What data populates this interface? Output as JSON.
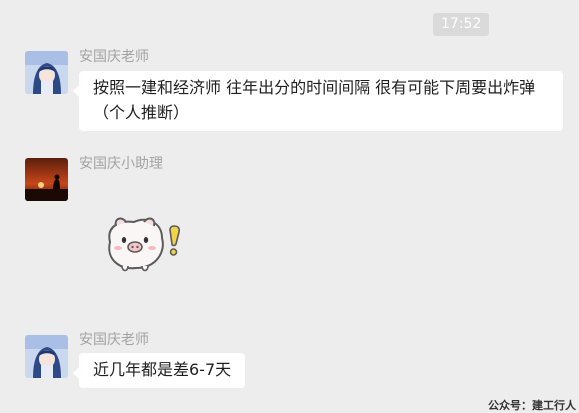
{
  "timestamp": "17:52",
  "messages": [
    {
      "sender": "安国庆老师",
      "avatar": "anime-girl-avatar-icon",
      "text": "按照一建和经济师  往年出分的时间间隔   很有可能下周要出炸弹（个人推断）"
    },
    {
      "sender": "安国庆小助理",
      "avatar": "sunset-silhouette-avatar-icon",
      "sticker": "pig-sticker-icon"
    },
    {
      "sender": "安国庆老师",
      "avatar": "anime-girl-avatar-icon",
      "text": "近几年都是差6-7天"
    }
  ],
  "watermark": "公众号：建工行人",
  "colors": {
    "background": "#ededed",
    "bubble": "#ffffff",
    "sender_name": "#a3a3a3"
  }
}
